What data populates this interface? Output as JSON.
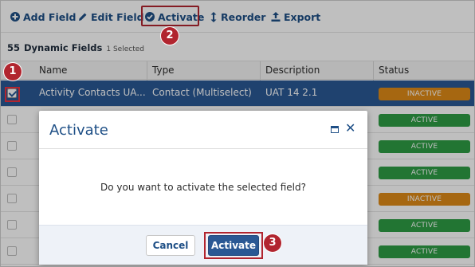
{
  "toolbar": {
    "add_label": "Add Field",
    "edit_label": "Edit Field",
    "activate_label": "Activate",
    "reorder_label": "Reorder",
    "export_label": "Export"
  },
  "info": {
    "count": "55",
    "title": "Dynamic Fields",
    "selected": "1 Selected"
  },
  "table": {
    "columns": [
      "Name",
      "Type",
      "Description",
      "Status"
    ],
    "rows": [
      {
        "checked": true,
        "name": "Activity Contacts UA...",
        "type": "Contact (Multiselect)",
        "description": "UAT 14 2.1",
        "status": "INACTIVE"
      },
      {
        "checked": false,
        "name": "",
        "type": "",
        "description": "",
        "status": "ACTIVE"
      },
      {
        "checked": false,
        "name": "",
        "type": "",
        "description": "",
        "status": "ACTIVE"
      },
      {
        "checked": false,
        "name": "",
        "type": "",
        "description": "",
        "status": "ACTIVE"
      },
      {
        "checked": false,
        "name": "",
        "type": "",
        "description": "",
        "status": "INACTIVE"
      },
      {
        "checked": false,
        "name": "",
        "type": "",
        "description": "",
        "status": "ACTIVE"
      },
      {
        "checked": false,
        "name": "",
        "type": "",
        "description": "",
        "status": "ACTIVE"
      }
    ]
  },
  "dialog": {
    "title": "Activate",
    "message": "Do you want to activate the selected field?",
    "cancel_label": "Cancel",
    "confirm_label": "Activate"
  },
  "markers": [
    "1",
    "2",
    "3"
  ],
  "colors": {
    "brand_blue": "#1e4f86",
    "selected_row": "#2a5894",
    "active_green": "#2e9c45",
    "inactive_orange": "#de8a17",
    "highlight_red": "#b1252f"
  }
}
